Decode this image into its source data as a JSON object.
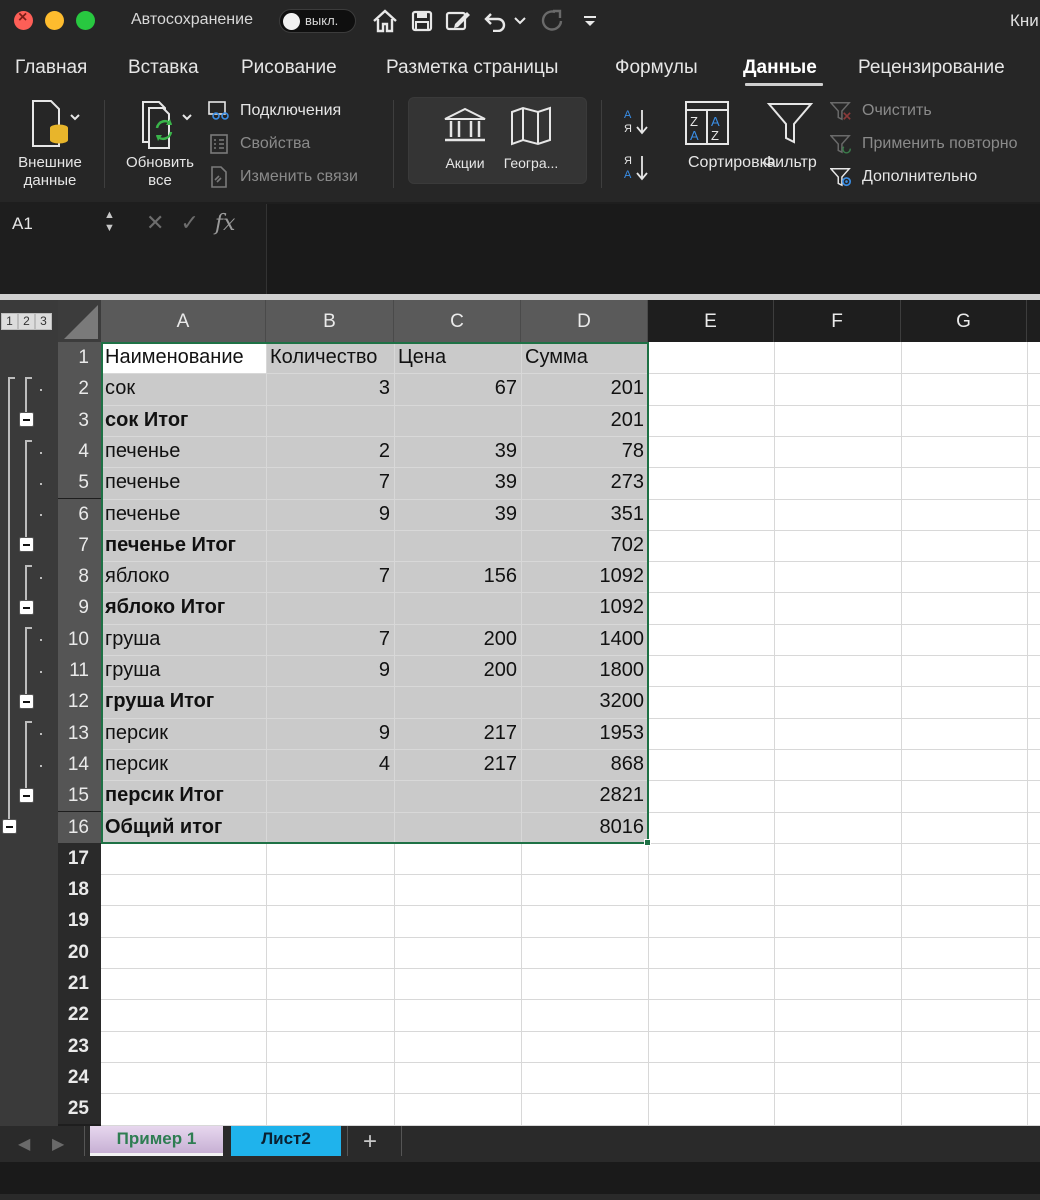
{
  "titlebar": {
    "autosave_label": "Автосохранение",
    "autosave_state": "выкл.",
    "doc_title": "Кни"
  },
  "menu_tabs": [
    "Главная",
    "Вставка",
    "Рисование",
    "Разметка страницы",
    "Формулы",
    "Данные",
    "Рецензирование"
  ],
  "active_tab": "Данные",
  "ribbon": {
    "external_data": "Внешние данные",
    "external_data_l1": "Внешние",
    "external_data_l2": "данные",
    "refresh_l1": "Обновить",
    "refresh_l2": "все",
    "connections": "Подключения",
    "properties": "Свойства",
    "edit_links": "Изменить связи",
    "stocks": "Акции",
    "geography": "Геогра...",
    "sort": "Сортировка",
    "filter": "Фильтр",
    "clear": "Очистить",
    "reapply": "Применить повторно",
    "advanced": "Дополнительно"
  },
  "formula_bar": {
    "cell_ref": "A1",
    "fx": "fx",
    "content": ""
  },
  "outline_levels": [
    "1",
    "2",
    "3"
  ],
  "columns": [
    "A",
    "B",
    "C",
    "D",
    "E",
    "F",
    "G"
  ],
  "rows": [
    "1",
    "2",
    "3",
    "4",
    "5",
    "6",
    "7",
    "8",
    "9",
    "10",
    "11",
    "12",
    "13",
    "14",
    "15",
    "16",
    "17",
    "18",
    "19",
    "20",
    "21",
    "22",
    "23",
    "24",
    "25"
  ],
  "table": {
    "headers": [
      "Наименование",
      "Количество",
      "Цена",
      "Сумма"
    ],
    "rows": [
      {
        "name": "сок",
        "qty": "3",
        "price": "67",
        "sum": "201",
        "subtotal": false
      },
      {
        "name": "сок Итог",
        "qty": "",
        "price": "",
        "sum": "201",
        "subtotal": true
      },
      {
        "name": "печенье",
        "qty": "2",
        "price": "39",
        "sum": "78",
        "subtotal": false
      },
      {
        "name": "печенье",
        "qty": "7",
        "price": "39",
        "sum": "273",
        "subtotal": false
      },
      {
        "name": "печенье",
        "qty": "9",
        "price": "39",
        "sum": "351",
        "subtotal": false
      },
      {
        "name": "печенье Итог",
        "qty": "",
        "price": "",
        "sum": "702",
        "subtotal": true
      },
      {
        "name": "яблоко",
        "qty": "7",
        "price": "156",
        "sum": "1092",
        "subtotal": false
      },
      {
        "name": "яблоко  Итог",
        "qty": "",
        "price": "",
        "sum": "1092",
        "subtotal": true
      },
      {
        "name": "груша",
        "qty": "7",
        "price": "200",
        "sum": "1400",
        "subtotal": false
      },
      {
        "name": "груша",
        "qty": "9",
        "price": "200",
        "sum": "1800",
        "subtotal": false
      },
      {
        "name": "груша Итог",
        "qty": "",
        "price": "",
        "sum": "3200",
        "subtotal": true
      },
      {
        "name": "персик",
        "qty": "9",
        "price": "217",
        "sum": "1953",
        "subtotal": false
      },
      {
        "name": "персик",
        "qty": "4",
        "price": "217",
        "sum": "868",
        "subtotal": false
      },
      {
        "name": "персик  Итог",
        "qty": "",
        "price": "",
        "sum": "2821",
        "subtotal": true
      },
      {
        "name": "Общий итог",
        "qty": "",
        "price": "",
        "sum": "8016",
        "subtotal": true
      }
    ]
  },
  "sheets": {
    "tab1": "Пример 1",
    "tab2": "Лист2",
    "add": "+"
  },
  "colors": {
    "selection_border": "#1e7145",
    "sheet2_tab": "#1fb3ec",
    "sheet1_text": "#2e7d52"
  }
}
